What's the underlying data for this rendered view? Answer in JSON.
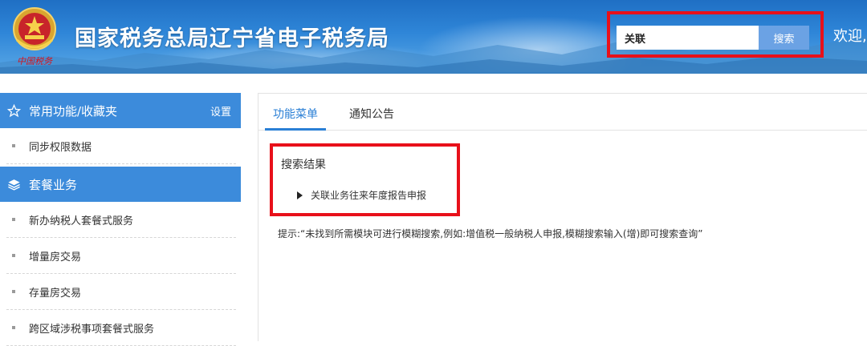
{
  "header": {
    "title": "国家税务总局辽宁省电子税务局",
    "emblem_caption": "中国税务",
    "welcome_text": "欢迎,",
    "search": {
      "value": "关联",
      "button_label": "搜索"
    }
  },
  "sidebar": {
    "favorites": {
      "title": "常用功能/收藏夹",
      "settings_label": "设置",
      "icon": "star-icon",
      "items": [
        {
          "label": "同步权限数据"
        }
      ]
    },
    "packages": {
      "title": "套餐业务",
      "icon": "layers-icon",
      "items": [
        {
          "label": "新办纳税人套餐式服务"
        },
        {
          "label": "增量房交易"
        },
        {
          "label": "存量房交易"
        },
        {
          "label": "跨区域涉税事项套餐式服务"
        }
      ]
    }
  },
  "main": {
    "tabs": [
      {
        "label": "功能菜单",
        "active": true
      },
      {
        "label": "通知公告",
        "active": false
      }
    ],
    "results": {
      "title": "搜索结果",
      "items": [
        {
          "label": "关联业务往来年度报告申报"
        }
      ]
    },
    "hint": "提示:“未找到所需模块可进行模糊搜索,例如:增值税一般纳税人申报,模糊搜索输入(增)即可搜索查询”"
  },
  "colors": {
    "header_blue": "#2f86d8",
    "sidebar_header": "#3c8bdb",
    "active_tab": "#2a7fd5",
    "highlight_red": "#e8101a",
    "search_button": "#6ba2e4"
  }
}
